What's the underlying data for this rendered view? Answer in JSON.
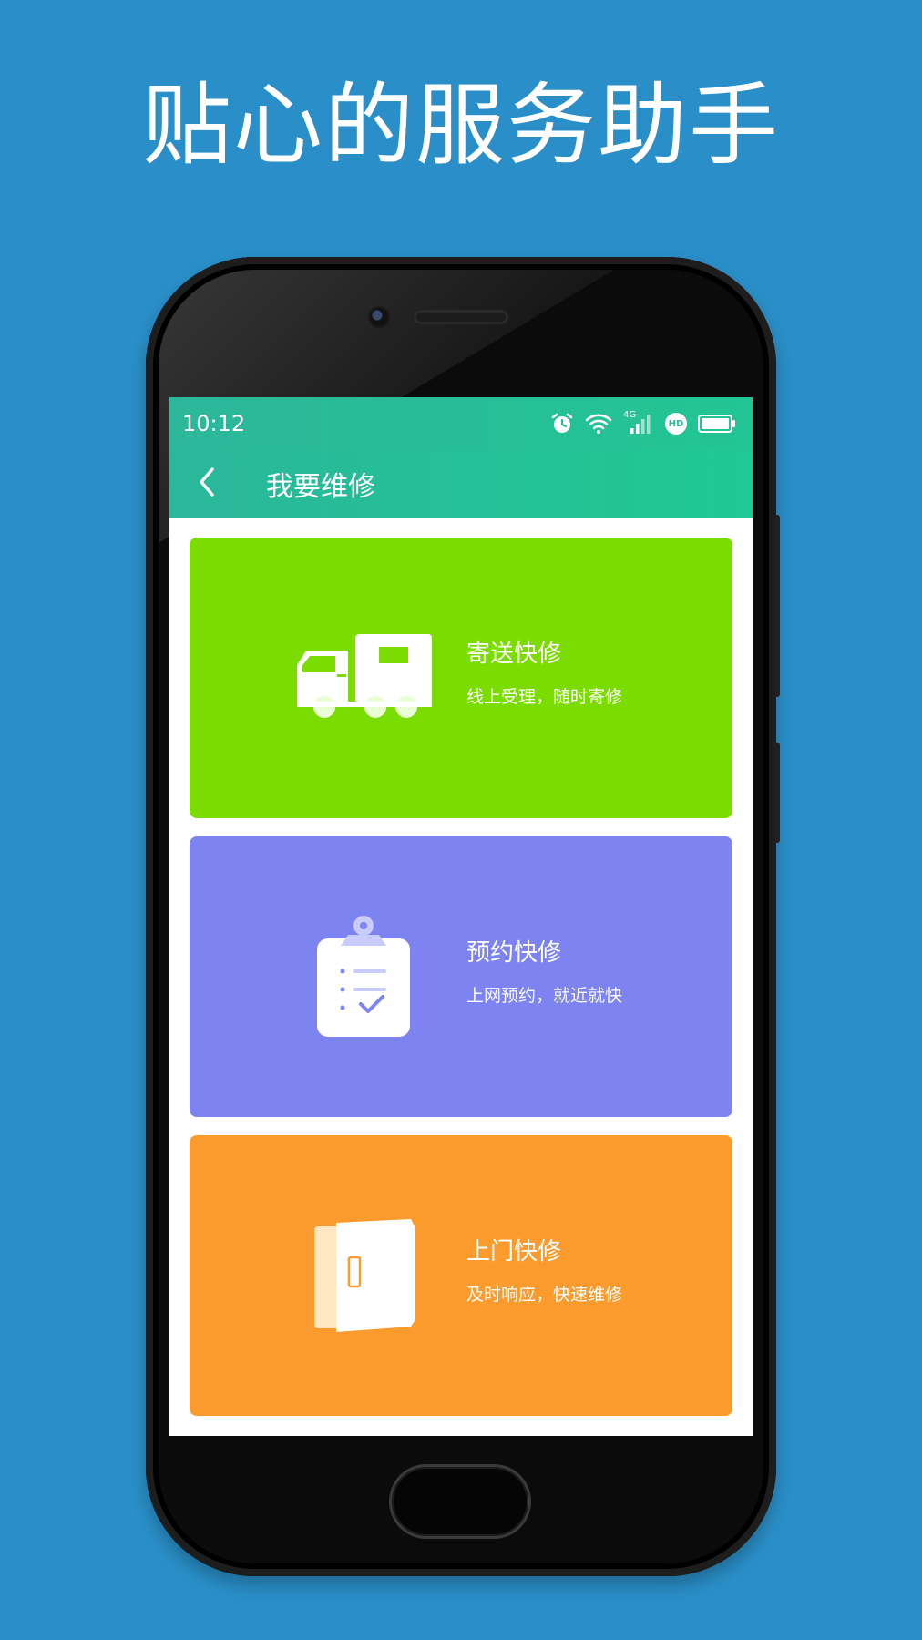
{
  "headline": "贴心的服务助手",
  "status": {
    "time": "10:12",
    "icons": [
      "alarm-icon",
      "wifi-icon",
      "signal-4g-icon",
      "hd-icon",
      "battery-icon"
    ],
    "network_label": "4G",
    "hd_label": "HD"
  },
  "toolbar": {
    "back_icon": "chevron-left-icon",
    "title": "我要维修"
  },
  "cards": [
    {
      "title": "寄送快修",
      "subtitle": "线上受理，随时寄修",
      "icon": "truck-icon",
      "color": "#7adc00"
    },
    {
      "title": "预约快修",
      "subtitle": "上网预约，就近就快",
      "icon": "clipboard-check-icon",
      "color": "#7d84f2"
    },
    {
      "title": "上门快修",
      "subtitle": "及时响应，快速维修",
      "icon": "door-icon",
      "color": "#fb9a2d"
    }
  ],
  "colors": {
    "background": "#2a8fc8",
    "toolbar_start": "#2ab79a",
    "toolbar_end": "#20c895"
  }
}
